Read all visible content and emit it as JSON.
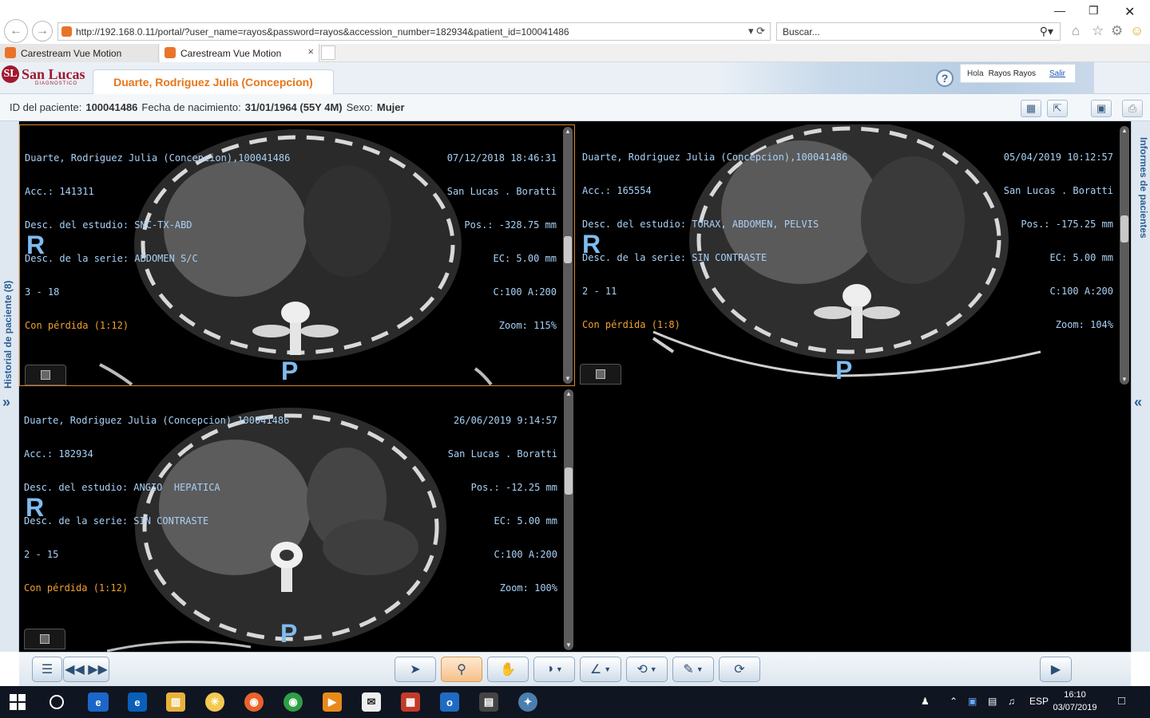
{
  "browser": {
    "url": "http://192.168.0.11/portal/?user_name=rayos&password=rayos&accession_number=182934&patient_id=100041486",
    "search_placeholder": "Buscar...",
    "tabs": [
      {
        "label": "Carestream Vue Motion"
      },
      {
        "label": "Carestream Vue Motion"
      }
    ]
  },
  "header": {
    "logo_name": "San Lucas",
    "logo_sub": "DIAGNOSTICO",
    "logo_mark": "SL",
    "patient_tab": "Duarte, Rodriguez Julia (Concepcion)",
    "greeting": "Hola",
    "user": "Rayos Rayos",
    "logout": "Salir"
  },
  "patient_bar": {
    "id_label": "ID del paciente:",
    "id_value": "100041486",
    "dob_label": "Fecha de nacimiento:",
    "dob_value": "31/01/1964 (55Y 4M)",
    "sex_label": "Sexo:",
    "sex_value": "Mujer"
  },
  "side_panels": {
    "left_label": "Historial de paciente (8)",
    "right_label": "Informes de pacientes",
    "left_arrow": "»",
    "right_arrow": "«"
  },
  "viewports": [
    {
      "left_lines": [
        "Duarte, Rodriguez Julia (Concepcion),100041486",
        "Acc.: 141311",
        "Desc. del estudio: SNC-TX-ABD",
        "Desc. de la serie: ABDOMEN S/C",
        "3 - 18"
      ],
      "loss": "Con pérdida (1:12)",
      "right_lines": [
        "07/12/2018 18:46:31",
        "San Lucas . Boratti",
        "Pos.: -328.75 mm",
        "EC: 5.00 mm",
        "C:100 A:200",
        "Zoom: 115%"
      ],
      "orient_r": "R",
      "orient_p": "P"
    },
    {
      "left_lines": [
        "Duarte, Rodriguez Julia (Concepcion),100041486",
        "Acc.: 165554",
        "Desc. del estudio: TORAX, ABDOMEN, PELVIS",
        "Desc. de la serie: SIN CONTRASTE",
        "2 - 11"
      ],
      "loss": "Con pérdida (1:8)",
      "right_lines": [
        "05/04/2019 10:12:57",
        "San Lucas . Boratti",
        "Pos.: -175.25 mm",
        "EC: 5.00 mm",
        "C:100 A:200",
        "Zoom: 104%"
      ],
      "orient_r": "R",
      "orient_p": "P"
    },
    {
      "left_lines": [
        "Duarte, Rodriguez Julia (Concepcion),100041486",
        "Acc.: 182934",
        "Desc. del estudio: ANGIO  HEPATICA",
        "Desc. de la serie: SIN CONTRASTE",
        "2 - 15"
      ],
      "loss": "Con pérdida (1:12)",
      "right_lines": [
        "26/06/2019 9:14:57",
        "San Lucas . Boratti",
        "Pos.: -12.25 mm",
        "EC: 5.00 mm",
        "C:100 A:200",
        "Zoom: 100%"
      ],
      "orient_r": "R",
      "orient_p": "P"
    }
  ],
  "taskbar": {
    "lang": "ESP",
    "time": "16:10",
    "date": "03/07/2019"
  },
  "colors": {
    "accent_orange": "#e6761b",
    "overlay_blue": "#a9d1f5",
    "overlay_orange": "#f0a030",
    "brand_red": "#a0182f"
  }
}
